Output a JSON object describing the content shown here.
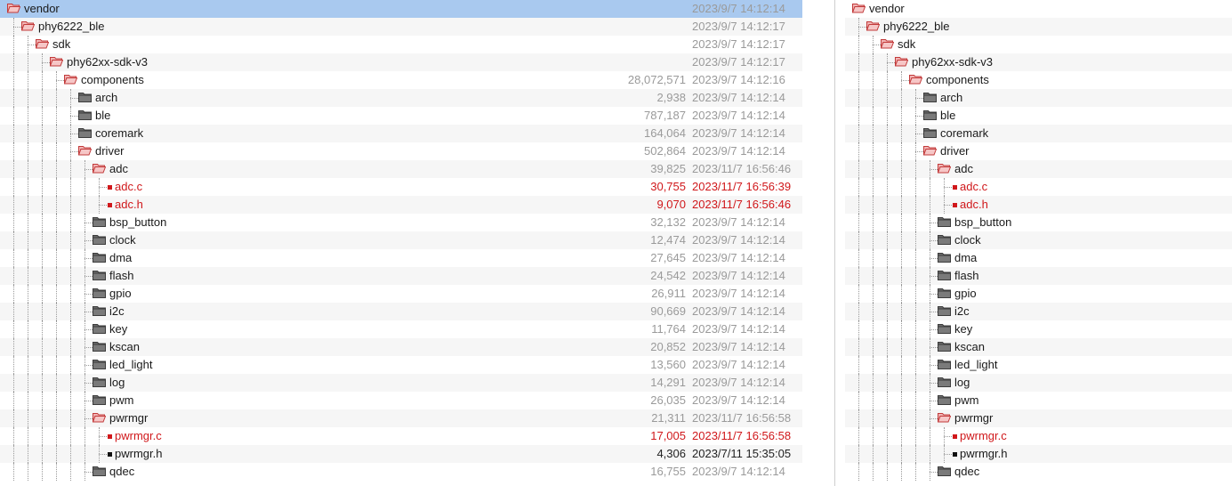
{
  "colors": {
    "diff": "#d0181b",
    "selected": "#a9c9ef",
    "folder_closed": "#555555",
    "folder_open": "#e34b4b"
  },
  "left_rows": [
    {
      "depth": 0,
      "type": "folder-open",
      "name": "vendor",
      "size": "",
      "date": "2023/9/7 14:12:14",
      "status": "",
      "selected": true
    },
    {
      "depth": 1,
      "type": "folder-open",
      "name": "phy6222_ble",
      "size": "",
      "date": "2023/9/7 14:12:17",
      "status": ""
    },
    {
      "depth": 2,
      "type": "folder-open",
      "name": "sdk",
      "size": "",
      "date": "2023/9/7 14:12:17",
      "status": ""
    },
    {
      "depth": 3,
      "type": "folder-open",
      "name": "phy62xx-sdk-v3",
      "size": "",
      "date": "2023/9/7 14:12:17",
      "status": ""
    },
    {
      "depth": 4,
      "type": "folder-open",
      "name": "components",
      "size": "28,072,571",
      "date": "2023/9/7 14:12:16",
      "status": ""
    },
    {
      "depth": 5,
      "type": "folder",
      "name": "arch",
      "size": "2,938",
      "date": "2023/9/7 14:12:14",
      "status": ""
    },
    {
      "depth": 5,
      "type": "folder",
      "name": "ble",
      "size": "787,187",
      "date": "2023/9/7 14:12:14",
      "status": ""
    },
    {
      "depth": 5,
      "type": "folder",
      "name": "coremark",
      "size": "164,064",
      "date": "2023/9/7 14:12:14",
      "status": ""
    },
    {
      "depth": 5,
      "type": "folder-open",
      "name": "driver",
      "size": "502,864",
      "date": "2023/9/7 14:12:14",
      "status": ""
    },
    {
      "depth": 6,
      "type": "folder-open",
      "name": "adc",
      "size": "39,825",
      "date": "2023/11/7 16:56:46",
      "status": ""
    },
    {
      "depth": 7,
      "type": "file",
      "name": "adc.c",
      "size": "30,755",
      "date": "2023/11/7 16:56:39",
      "status": "diff",
      "mark": "≠"
    },
    {
      "depth": 7,
      "type": "file",
      "name": "adc.h",
      "size": "9,070",
      "date": "2023/11/7 16:56:46",
      "status": "diff",
      "mark": "≠"
    },
    {
      "depth": 6,
      "type": "folder",
      "name": "bsp_button",
      "size": "32,132",
      "date": "2023/9/7 14:12:14",
      "status": ""
    },
    {
      "depth": 6,
      "type": "folder",
      "name": "clock",
      "size": "12,474",
      "date": "2023/9/7 14:12:14",
      "status": ""
    },
    {
      "depth": 6,
      "type": "folder",
      "name": "dma",
      "size": "27,645",
      "date": "2023/9/7 14:12:14",
      "status": ""
    },
    {
      "depth": 6,
      "type": "folder",
      "name": "flash",
      "size": "24,542",
      "date": "2023/9/7 14:12:14",
      "status": ""
    },
    {
      "depth": 6,
      "type": "folder",
      "name": "gpio",
      "size": "26,911",
      "date": "2023/9/7 14:12:14",
      "status": ""
    },
    {
      "depth": 6,
      "type": "folder",
      "name": "i2c",
      "size": "90,669",
      "date": "2023/9/7 14:12:14",
      "status": ""
    },
    {
      "depth": 6,
      "type": "folder",
      "name": "key",
      "size": "11,764",
      "date": "2023/9/7 14:12:14",
      "status": ""
    },
    {
      "depth": 6,
      "type": "folder",
      "name": "kscan",
      "size": "20,852",
      "date": "2023/9/7 14:12:14",
      "status": ""
    },
    {
      "depth": 6,
      "type": "folder",
      "name": "led_light",
      "size": "13,560",
      "date": "2023/9/7 14:12:14",
      "status": ""
    },
    {
      "depth": 6,
      "type": "folder",
      "name": "log",
      "size": "14,291",
      "date": "2023/9/7 14:12:14",
      "status": ""
    },
    {
      "depth": 6,
      "type": "folder",
      "name": "pwm",
      "size": "26,035",
      "date": "2023/9/7 14:12:14",
      "status": ""
    },
    {
      "depth": 6,
      "type": "folder-open",
      "name": "pwrmgr",
      "size": "21,311",
      "date": "2023/11/7 16:56:58",
      "status": ""
    },
    {
      "depth": 7,
      "type": "file",
      "name": "pwrmgr.c",
      "size": "17,005",
      "date": "2023/11/7 16:56:58",
      "status": "diff",
      "mark": "≠"
    },
    {
      "depth": 7,
      "type": "file",
      "name": "pwrmgr.h",
      "size": "4,306",
      "date": "2023/7/11 15:35:05",
      "status": "normal",
      "mark": "⁰¹="
    },
    {
      "depth": 6,
      "type": "folder",
      "name": "qdec",
      "size": "16,755",
      "date": "2023/9/7 14:12:14",
      "status": ""
    }
  ],
  "right_rows": [
    {
      "depth": 0,
      "type": "folder-open",
      "name": "vendor",
      "status": ""
    },
    {
      "depth": 1,
      "type": "folder-open",
      "name": "phy6222_ble",
      "status": ""
    },
    {
      "depth": 2,
      "type": "folder-open",
      "name": "sdk",
      "status": ""
    },
    {
      "depth": 3,
      "type": "folder-open",
      "name": "phy62xx-sdk-v3",
      "status": ""
    },
    {
      "depth": 4,
      "type": "folder-open",
      "name": "components",
      "status": ""
    },
    {
      "depth": 5,
      "type": "folder",
      "name": "arch",
      "status": ""
    },
    {
      "depth": 5,
      "type": "folder",
      "name": "ble",
      "status": ""
    },
    {
      "depth": 5,
      "type": "folder",
      "name": "coremark",
      "status": ""
    },
    {
      "depth": 5,
      "type": "folder-open",
      "name": "driver",
      "status": ""
    },
    {
      "depth": 6,
      "type": "folder-open",
      "name": "adc",
      "status": ""
    },
    {
      "depth": 7,
      "type": "file",
      "name": "adc.c",
      "status": "diff"
    },
    {
      "depth": 7,
      "type": "file",
      "name": "adc.h",
      "status": "diff"
    },
    {
      "depth": 6,
      "type": "folder",
      "name": "bsp_button",
      "status": ""
    },
    {
      "depth": 6,
      "type": "folder",
      "name": "clock",
      "status": ""
    },
    {
      "depth": 6,
      "type": "folder",
      "name": "dma",
      "status": ""
    },
    {
      "depth": 6,
      "type": "folder",
      "name": "flash",
      "status": ""
    },
    {
      "depth": 6,
      "type": "folder",
      "name": "gpio",
      "status": ""
    },
    {
      "depth": 6,
      "type": "folder",
      "name": "i2c",
      "status": ""
    },
    {
      "depth": 6,
      "type": "folder",
      "name": "key",
      "status": ""
    },
    {
      "depth": 6,
      "type": "folder",
      "name": "kscan",
      "status": ""
    },
    {
      "depth": 6,
      "type": "folder",
      "name": "led_light",
      "status": ""
    },
    {
      "depth": 6,
      "type": "folder",
      "name": "log",
      "status": ""
    },
    {
      "depth": 6,
      "type": "folder",
      "name": "pwm",
      "status": ""
    },
    {
      "depth": 6,
      "type": "folder-open",
      "name": "pwrmgr",
      "status": ""
    },
    {
      "depth": 7,
      "type": "file",
      "name": "pwrmgr.c",
      "status": "diff"
    },
    {
      "depth": 7,
      "type": "file",
      "name": "pwrmgr.h",
      "status": "normal"
    },
    {
      "depth": 6,
      "type": "folder",
      "name": "qdec",
      "status": ""
    }
  ]
}
